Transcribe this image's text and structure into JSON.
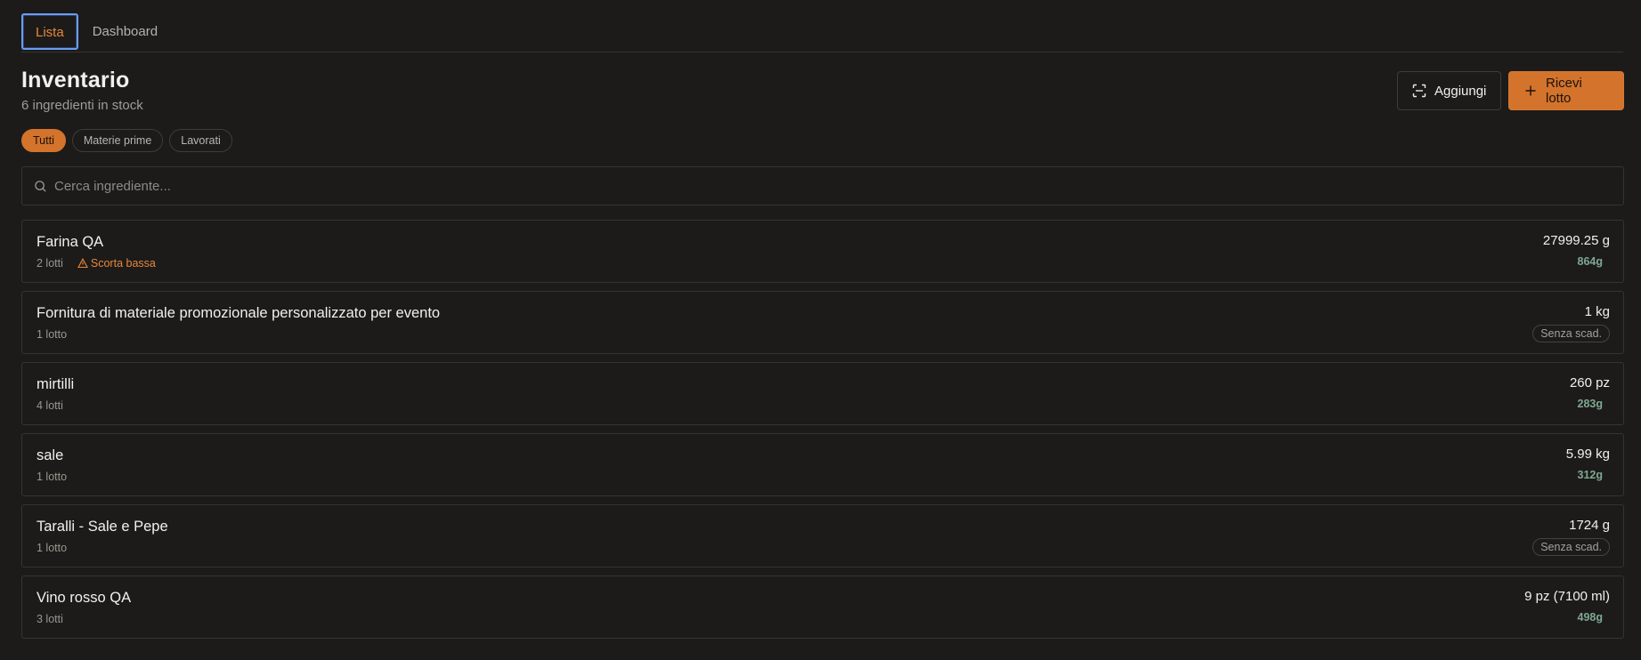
{
  "tabs": [
    {
      "label": "Lista",
      "active": true
    },
    {
      "label": "Dashboard",
      "active": false
    }
  ],
  "header": {
    "title": "Inventario",
    "subtitle": "6 ingredienti in stock"
  },
  "actions": {
    "add_label": "Aggiungi",
    "receive_label": "Ricevi lotto"
  },
  "filters": [
    {
      "label": "Tutti",
      "active": true
    },
    {
      "label": "Materie prime",
      "active": false
    },
    {
      "label": "Lavorati",
      "active": false
    }
  ],
  "search": {
    "placeholder": "Cerca ingrediente...",
    "value": ""
  },
  "items": [
    {
      "name": "Farina QA",
      "lots": "2 lotti",
      "warning": "Scorta bassa",
      "quantity": "27999.25 g",
      "secondary": "864g",
      "secondary_type": "value"
    },
    {
      "name": "Fornitura di materiale promozionale personalizzato per evento",
      "lots": "1 lotto",
      "warning": "",
      "quantity": "1 kg",
      "secondary": "Senza scad.",
      "secondary_type": "badge"
    },
    {
      "name": "mirtilli",
      "lots": "4 lotti",
      "warning": "",
      "quantity": "260 pz",
      "secondary": "283g",
      "secondary_type": "value"
    },
    {
      "name": "sale",
      "lots": "1 lotto",
      "warning": "",
      "quantity": "5.99 kg",
      "secondary": "312g",
      "secondary_type": "value"
    },
    {
      "name": "Taralli - Sale e Pepe",
      "lots": "1 lotto",
      "warning": "",
      "quantity": "1724 g",
      "secondary": "Senza scad.",
      "secondary_type": "badge"
    },
    {
      "name": "Vino rosso QA",
      "lots": "3 lotti",
      "warning": "",
      "quantity": "9 pz (7100 ml)",
      "secondary": "498g",
      "secondary_type": "value"
    }
  ],
  "colors": {
    "accent": "#d3732c",
    "background": "#1c1b1a",
    "border": "#363432",
    "good": "#7fa891"
  }
}
